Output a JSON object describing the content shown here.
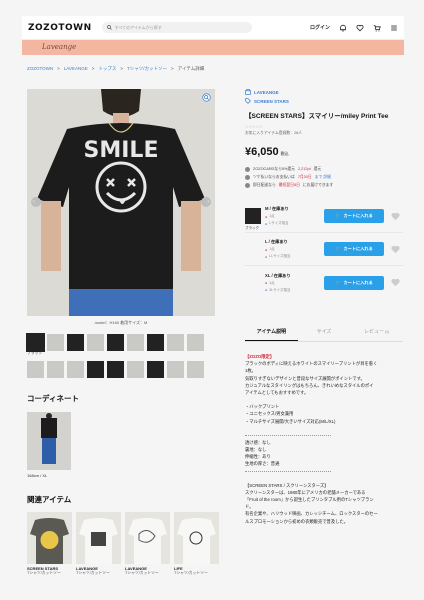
{
  "header": {
    "logo": "ZOZOTOWN",
    "search_placeholder": "すべてのアイテムから探す",
    "login": "ログイン",
    "banner_brand": "Laveange",
    "colors": {
      "banner": "#f3b6a0",
      "link": "#3c7ecf",
      "cart": "#2aa0e8",
      "sale": "#d0283c"
    }
  },
  "breadcrumbs": [
    "ZOZOTOWN",
    "LAVEANGE",
    "トップス",
    "Tシャツ/カットソー",
    "アイテム詳細"
  ],
  "gallery": {
    "main_text": "SMILE",
    "caption": "model：H160 着用サイズ：M",
    "selected_label": "ブラック",
    "thumb_count": 18
  },
  "coordinate": {
    "title": "コーディネート",
    "caption": "168cm / XL"
  },
  "related": {
    "title": "関連アイテム",
    "items": [
      {
        "brand": "SCREEN STARS",
        "category": "Tシャツ/カットソー"
      },
      {
        "brand": "LAVEANGE",
        "category": "Tシャツ/カットソー"
      },
      {
        "brand": "LAVEANGE",
        "category": "Tシャツ/カットソー"
      },
      {
        "brand": "LIFE",
        "category": "Tシャツ/カットソー"
      }
    ]
  },
  "product": {
    "brand": "LAVEANGE",
    "sub_brand": "SCREEN STARS",
    "title": "【SCREEN STARS】スマイリー/miley Print Tee",
    "rating_stars": "☆☆☆☆☆",
    "fav_count": "お気に入りアイテム登録数：26人",
    "price": "¥6,050",
    "tax": "税込",
    "points": [
      {
        "pre": "ZOZOCARDなら5%還元",
        "em": "2,212pt",
        "post": "還元"
      },
      {
        "pre": "ツケ払いならお支払いは",
        "em": "7月30日",
        "post": "まで 詳細"
      },
      {
        "pre": "即日配送なら",
        "em": "最短翌日8日",
        "post": "にお届けできます"
      }
    ],
    "skus": [
      {
        "color": "ブラック",
        "size": "M / 在庫あり",
        "line1": "1点",
        "line2": "Lサイズ相当"
      },
      {
        "color": "",
        "size": "L / 在庫あり",
        "line1": "1点",
        "line2": "LLサイズ相当"
      },
      {
        "color": "",
        "size": "XL / 在庫あり",
        "line1": "1点",
        "line2": "3Lサイズ相当"
      }
    ],
    "cart_label": "カートに入れる"
  },
  "tabs": [
    {
      "label": "アイテム説明",
      "count": ""
    },
    {
      "label": "サイズ",
      "count": ""
    },
    {
      "label": "レビュー",
      "count": "(0)"
    }
  ],
  "description": {
    "heading": "【ZOZO限定】",
    "lines": [
      "ブラックのボディに映えるホワイトのスマイリープリントが目を惹く",
      "1枚。",
      "気取りすぎないデザインと普段なサイズ展開がポイントです。",
      "カジュアルなスタイリングはもちろん、きれいめなスタイルのポイ",
      "アイテムとしてもおすすめです。",
      "",
      "・バックプリント",
      "・ユニセックス/男女兼用",
      "・マルチサイズ展開/大きいサイズ対応(M/L/XL)",
      "",
      "---",
      "透け感：なし",
      "裏地：なし",
      "伸縮性：あり",
      "生地の厚さ：普通",
      "---",
      "",
      "【SCREEN STARS / スクリーンスターズ】",
      "スクリーンスターは、1980年にアメリカの老舗メーカーである",
      "「Fruit of the room」から誕生したプリンタブル用のTシャツブラン",
      "ド。",
      "有名企業や、ハリウッド映画、カレッジチーム、ロックスターのセー",
      "ルスプロモーションから初めの衣類販売で普及した。"
    ]
  }
}
